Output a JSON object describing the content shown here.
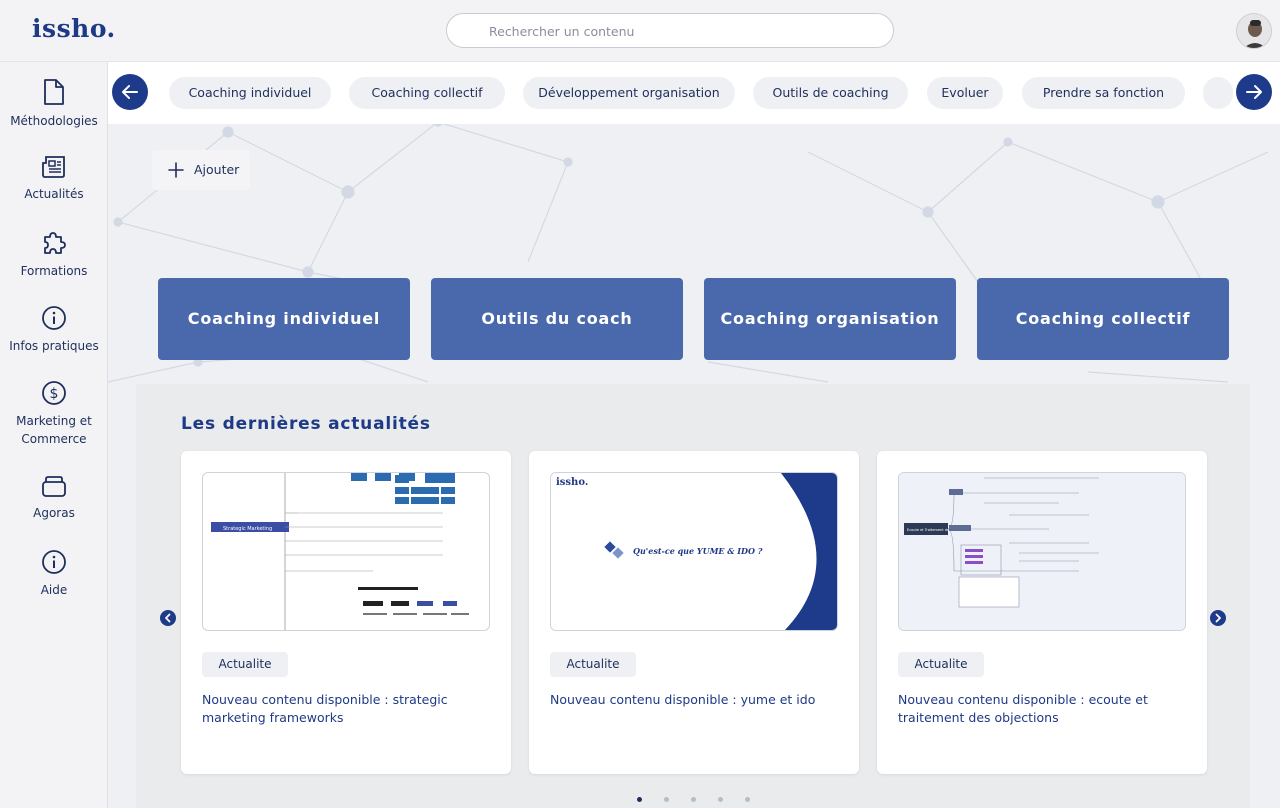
{
  "header": {
    "logo": "issho.",
    "search_placeholder": "Rechercher un contenu"
  },
  "sidebar": {
    "items": [
      {
        "label": "Méthodologies",
        "icon": "document-icon"
      },
      {
        "label": "Actualités",
        "icon": "newspaper-icon"
      },
      {
        "label": "Formations",
        "icon": "puzzle-icon"
      },
      {
        "label": "Infos pratiques",
        "icon": "info-icon"
      },
      {
        "label": "Marketing et Commerce",
        "icon": "dollar-icon"
      },
      {
        "label": "Agoras",
        "icon": "folder-icon"
      },
      {
        "label": "Aide",
        "icon": "info-icon"
      }
    ]
  },
  "categories": [
    "Coaching individuel",
    "Coaching collectif",
    "Développement organisation",
    "Outils de coaching",
    "Evoluer",
    "Prendre sa fonction"
  ],
  "add_label": "Ajouter",
  "big_cards": [
    "Coaching individuel",
    "Outils du coach",
    "Coaching organisation",
    "Coaching collectif"
  ],
  "news": {
    "title": "Les dernières actualités",
    "cards": [
      {
        "tag": "Actualite",
        "text": "Nouveau contenu disponible : strategic marketing frameworks",
        "thumb_title": "Strategic Marketing"
      },
      {
        "tag": "Actualite",
        "text": "Nouveau contenu disponible : yume et ido",
        "thumb_title": "Qu'est-ce que YUME & IDO ?",
        "thumb_logo": "issho."
      },
      {
        "tag": "Actualite",
        "text": "Nouveau contenu disponible : ecoute et traitement des objections",
        "thumb_title": "Ecoute et Traitement des objections"
      }
    ],
    "pages": 5,
    "active_page": 1
  },
  "colors": {
    "brand": "#1e3a86",
    "card_blue": "#4a68ac",
    "arrow": "#1e3a8a"
  }
}
